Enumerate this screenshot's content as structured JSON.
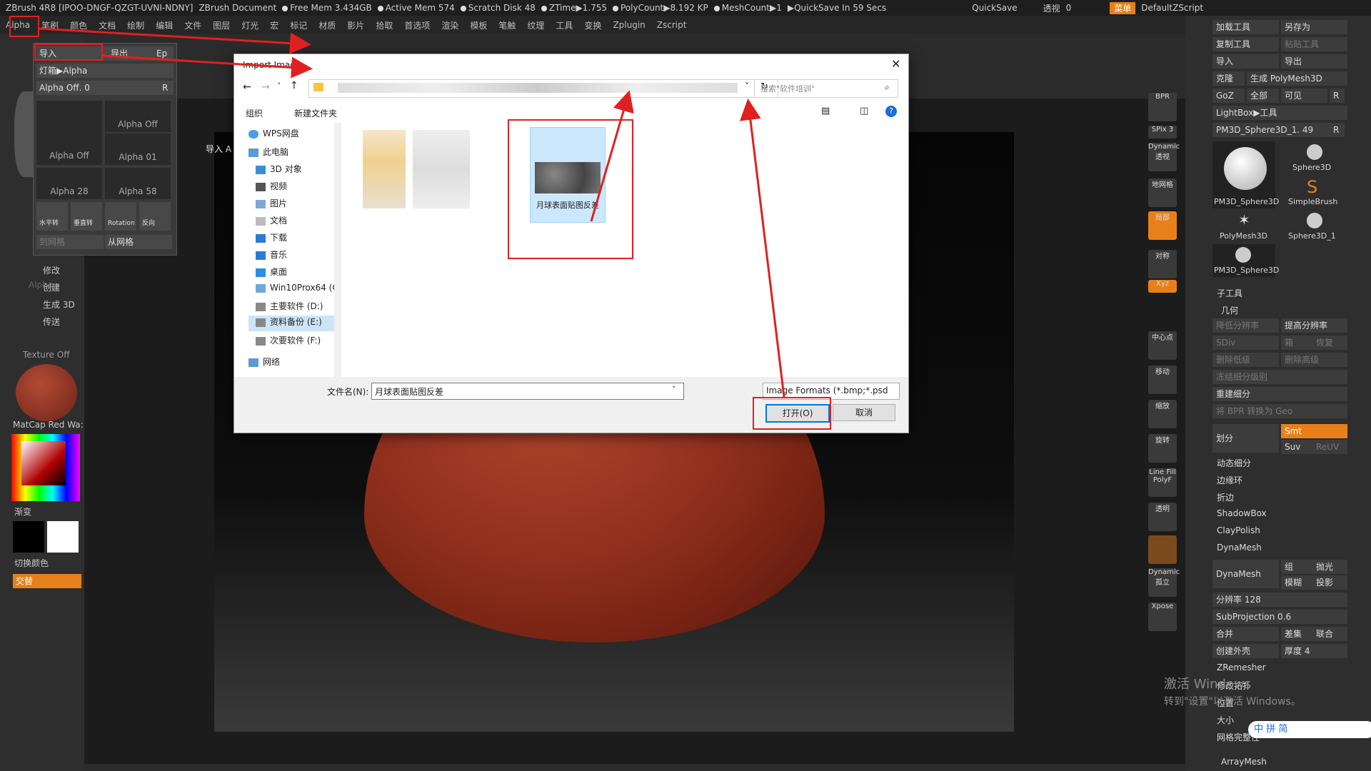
{
  "titlebar": {
    "app": "ZBrush 4R8 [IPOO-DNGF-QZGT-UVNI-NDNY]",
    "doc": "ZBrush Document",
    "free_mem": "Free Mem 3.434GB",
    "active_mem": "Active Mem 574",
    "scratch": "Scratch Disk 48",
    "ztime": "ZTime▶1.755",
    "polycount": "PolyCount▶8.192 KP",
    "meshcount": "MeshCount▶1",
    "quicksave_in": "▶QuickSave In 59 Secs",
    "quicksave": "QuickSave",
    "transparency": "透视",
    "transparency_val": "0",
    "menu_btn": "菜单",
    "script": "DefaultZScript"
  },
  "menubar": [
    "Alpha",
    "笔刷",
    "颜色",
    "文档",
    "绘制",
    "编辑",
    "文件",
    "图层",
    "灯光",
    "宏",
    "标记",
    "材质",
    "影片",
    "拾取",
    "首选项",
    "渲染",
    "模板",
    "笔触",
    "纹理",
    "工具",
    "变换",
    "Zplugin",
    "Zscript"
  ],
  "alpha_popup": {
    "import": "导入",
    "export": "导出",
    "ep": "Ep",
    "lightbox": "灯箱▶Alpha",
    "alpha_off": "Alpha Off. 0",
    "r": "R",
    "thumbs": [
      "Alpha Off",
      "Alpha Off",
      "Alpha 01",
      "Alpha 28",
      "Alpha 58"
    ],
    "tools": [
      "水平转",
      "垂直转",
      "Rotation",
      "反向"
    ],
    "from_mesh_to": "到网格",
    "from_mesh": "从网格"
  },
  "left_panel": {
    "items": [
      "修改",
      "创建",
      "生成 3D",
      "传送"
    ],
    "texture_off": "Texture Off",
    "matcap": "MatCap Red Wa:",
    "gradient": "渐变",
    "switch_color": "切换颜色",
    "alternate": "交替",
    "alpha_faded": "Alpha",
    "import_hint": "导入 A"
  },
  "dialog": {
    "title": "Import Image",
    "search_placeholder": "搜索\"软件培训\"",
    "organize": "组织",
    "new_folder": "新建文件夹",
    "nav": [
      "WPS网盘",
      "此电脑",
      "3D 对象",
      "视频",
      "图片",
      "文档",
      "下载",
      "音乐",
      "桌面",
      "Win10Prox64 (C",
      "主要软件 (D:)",
      "资料备份 (E:)",
      "次要软件 (F:)",
      "网络"
    ],
    "selected_file": "月球表面贴图反差",
    "filename_label": "文件名(N):",
    "filename_value": "月球表面贴图反差",
    "filetype": "Image Formats (*.bmp;*.psd",
    "open": "打开(O)",
    "cancel": "取消"
  },
  "right_panel": {
    "load_tool": "加载工具",
    "save_as": "另存为",
    "copy_tool": "复制工具",
    "paste_tool": "粘贴工具",
    "import": "导入",
    "export": "导出",
    "clone": "克隆",
    "make_polymesh": "生成 PolyMesh3D",
    "goz": "GoZ",
    "all": "全部",
    "visible": "可见",
    "r": "R",
    "lightbox_tool": "LightBox▶工具",
    "pm3d": "PM3D_Sphere3D_1. 49",
    "tools": [
      "PM3D_Sphere3D",
      "Sphere3D",
      "SimpleBrush",
      "PolyMesh3D",
      "Sphere3D_1",
      "PM3D_Sphere3D"
    ],
    "subtool": "子工具",
    "geometry": "几何",
    "lower_res": "降低分辨率",
    "higher_res": "提高分辨率",
    "sdiv": "SDiv",
    "cage": "箱",
    "restore": "恢复",
    "del_lower": "删除低级",
    "del_higher": "删除高级",
    "freeze": "冻结细分级别",
    "reconstruct": "重建细分",
    "bpr_geo": "将 BPR 转换为 Geo",
    "divide": "划分",
    "smt": "Smt",
    "suv": "Suv",
    "reuv": "ReUV",
    "dyn_sub": "动态细分",
    "edgeloop": "边缘环",
    "crease": "折边",
    "shadowbox": "ShadowBox",
    "claypolish": "ClayPolish",
    "dynamesh_hdr": "DynaMesh",
    "dynamesh": "DynaMesh",
    "group": "组",
    "polish": "抛光",
    "blur": "模糊",
    "project": "投影",
    "resolution": "分辨率 128",
    "subprojection": "SubProjection 0.6",
    "merge": "合并",
    "diff": "差集",
    "union": "联合",
    "create_shell": "创建外壳",
    "thickness": "厚度 4",
    "zremesher": "ZRemesher",
    "modtopo": "修改拓扑",
    "position": "位置",
    "size": "大小",
    "meshintegrity": "网格完整性",
    "arraymesh": "ArrayMesh"
  },
  "toolbar_icons": [
    "BPR",
    "SPix 3",
    "Dynamic 透视",
    "地网格",
    "局部",
    "对称",
    "Xyz",
    "中心点",
    "移动",
    "缩放",
    "旋转",
    "Line Fill PolyF",
    "透明",
    "Dynamic 孤立",
    "Xpose"
  ],
  "watermark": {
    "line1": "激活 Windows",
    "line2": "转到\"设置\"以激活 Windows。"
  },
  "ime": [
    "中",
    "拼",
    "简"
  ]
}
